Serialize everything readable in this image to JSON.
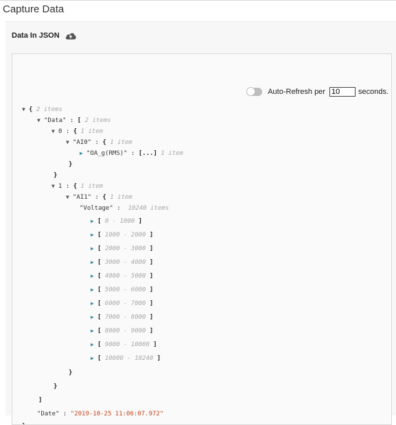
{
  "page": {
    "title": "Capture Data"
  },
  "panel": {
    "header": "Data In JSON",
    "cloud_icon": "cloud-upload-icon"
  },
  "refresh": {
    "label": "Auto-Refresh per",
    "interval": "10",
    "unit": "seconds."
  },
  "json": {
    "root_meta": "2 items",
    "data_key": "\"Data\"",
    "data_meta": "2 items",
    "item0_index": "0",
    "item0_meta": "1 item",
    "ai0_key": "\"AI0\"",
    "ai0_meta": "1 item",
    "oa_key": "\"OA_g(RMS)\"",
    "oa_collapsed": "[...]",
    "oa_meta": "1 item",
    "item1_index": "1",
    "item1_meta": "1 item",
    "ai1_key": "\"AI1\"",
    "ai1_meta": "1 item",
    "voltage_key": "\"Voltage\"",
    "voltage_meta": "10240 items",
    "ranges": [
      "0 - 1000",
      "1000 - 2000",
      "2000 - 3000",
      "3000 - 4000",
      "4000 - 5000",
      "5000 - 6000",
      "6000 - 7000",
      "7000 - 8000",
      "8000 - 9000",
      "9000 - 10000",
      "10000 - 10240"
    ],
    "date_key": "\"Date\"",
    "date_value": "\"2019-10-25 11:06:07.972\""
  }
}
